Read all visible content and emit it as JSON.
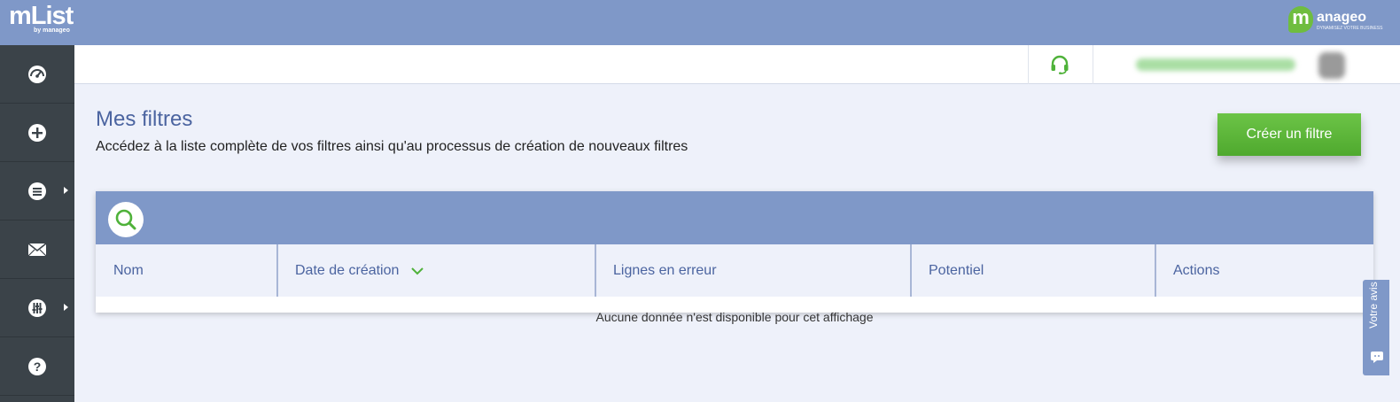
{
  "app": {
    "logo_main": "mList",
    "logo_sub": "by manageo",
    "brand_badge": "m",
    "brand_name": "anageo",
    "brand_tagline": "DYNAMISEZ VOTRE BUSINESS"
  },
  "sidebar": {
    "items": [
      {
        "icon": "dashboard-icon",
        "has_submenu": false
      },
      {
        "icon": "plus-icon",
        "has_submenu": false
      },
      {
        "icon": "list-icon",
        "has_submenu": true
      },
      {
        "icon": "mail-icon",
        "has_submenu": false
      },
      {
        "icon": "sliders-icon",
        "has_submenu": true
      },
      {
        "icon": "help-icon",
        "has_submenu": false
      }
    ]
  },
  "header": {
    "support_icon": "headset-icon",
    "support_color": "#4fb23a"
  },
  "page": {
    "title": "Mes filtres",
    "description": "Accédez à la liste complète de vos filtres ainsi qu'au processus de création de nouveaux filtres",
    "create_button": "Créer un filtre"
  },
  "table": {
    "columns": [
      "Nom",
      "Date de création",
      "Lignes en erreur",
      "Potentiel",
      "Actions"
    ],
    "sorted_column": "Date de création",
    "empty_message": "Aucune donnée n'est disponible pour cet affichage"
  },
  "feedback": {
    "label": "Votre avis"
  },
  "colors": {
    "primary": "#7f98c8",
    "sidebar": "#3b4349",
    "accent_green": "#5cb53a",
    "title": "#4b64a0"
  }
}
